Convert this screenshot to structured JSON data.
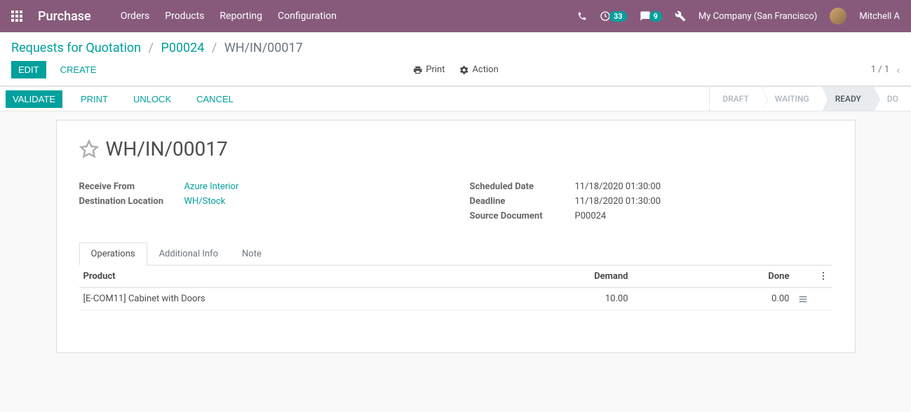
{
  "navbar": {
    "brand": "Purchase",
    "menu": [
      "Orders",
      "Products",
      "Reporting",
      "Configuration"
    ],
    "activities_count": "33",
    "messages_count": "9",
    "company": "My Company (San Francisco)",
    "user": "Mitchell A"
  },
  "breadcrumb": {
    "items": [
      "Requests for Quotation",
      "P00024"
    ],
    "current": "WH/IN/00017"
  },
  "buttons": {
    "edit": "EDIT",
    "create": "CREATE",
    "print": "Print",
    "action": "Action",
    "validate": "VALIDATE",
    "print2": "PRINT",
    "unlock": "UNLOCK",
    "cancel": "CANCEL"
  },
  "pager": {
    "value": "1 / 1"
  },
  "status_steps": {
    "draft": "DRAFT",
    "waiting": "WAITING",
    "ready": "READY",
    "done": "DO"
  },
  "doc": {
    "title": "WH/IN/00017",
    "fields_left": {
      "receive_from_label": "Receive From",
      "receive_from_value": "Azure Interior",
      "destination_label": "Destination Location",
      "destination_value": "WH/Stock"
    },
    "fields_right": {
      "scheduled_label": "Scheduled Date",
      "scheduled_value": "11/18/2020 01:30:00",
      "deadline_label": "Deadline",
      "deadline_value": "11/18/2020 01:30:00",
      "source_label": "Source Document",
      "source_value": "P00024"
    }
  },
  "tabs": {
    "operations": "Operations",
    "additional": "Additional Info",
    "note": "Note"
  },
  "table": {
    "headers": {
      "product": "Product",
      "demand": "Demand",
      "done": "Done"
    },
    "rows": [
      {
        "product": "[E-COM11] Cabinet with Doors",
        "demand": "10.00",
        "done": "0.00"
      }
    ]
  }
}
